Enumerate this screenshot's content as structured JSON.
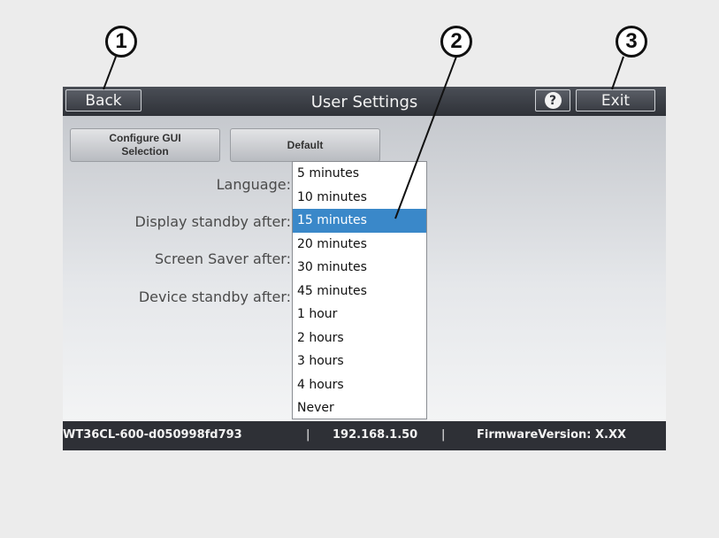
{
  "callouts": [
    "1",
    "2",
    "3"
  ],
  "header": {
    "back_label": "Back",
    "title": "User Settings",
    "help_symbol": "?",
    "exit_label": "Exit"
  },
  "buttons": {
    "configure_gui": "Configure GUI Selection",
    "default": "Default"
  },
  "form": {
    "language_label": "Language:",
    "display_standby_label": "Display standby after:",
    "screen_saver_label": "Screen Saver after:",
    "device_standby_label": "Device standby after:"
  },
  "dropdown": {
    "selected": "15 minutes",
    "options": [
      "5 minutes",
      "10 minutes",
      "15 minutes",
      "20 minutes",
      "30 minutes",
      "45 minutes",
      "1 hour",
      "2 hours",
      "3 hours",
      "4 hours",
      "Never"
    ]
  },
  "status": {
    "hostname": "WT36CL-600-d050998fd793",
    "separator": "|",
    "ip": "192.168.1.50",
    "firmware": "FirmwareVersion: X.XX"
  },
  "colors": {
    "titlebar": "#3a3d44",
    "selection": "#3a88c9",
    "statusbar": "#2e3036"
  }
}
